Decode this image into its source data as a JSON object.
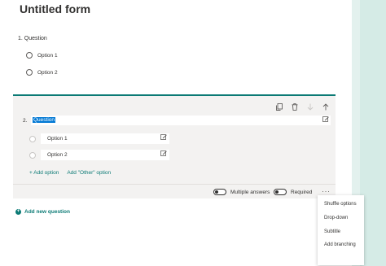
{
  "form": {
    "title": "Untitled form"
  },
  "question1": {
    "title": "1. Question",
    "options": [
      "Option 1",
      "Option 2"
    ]
  },
  "question2": {
    "number": "2.",
    "title": "Question",
    "options": [
      "Option 1",
      "Option 2"
    ],
    "add_option_label": "+ Add option",
    "add_other_label": "Add \"Other\" option",
    "multiple_answers_label": "Multiple answers",
    "required_label": "Required",
    "multiple_answers_on": false,
    "required_on": false,
    "more_label": "···"
  },
  "toolbar_icons": [
    "copy-icon",
    "delete-icon",
    "move-down-icon",
    "move-up-icon"
  ],
  "add_new_question_label": "Add new question",
  "more_menu": {
    "items": [
      "Shuffle options",
      "Drop-down",
      "Subtitle",
      "Add branching"
    ]
  },
  "colors": {
    "accent": "#0b7a75",
    "selection": "#0078d4",
    "theme_band": "#d5ebe6"
  }
}
